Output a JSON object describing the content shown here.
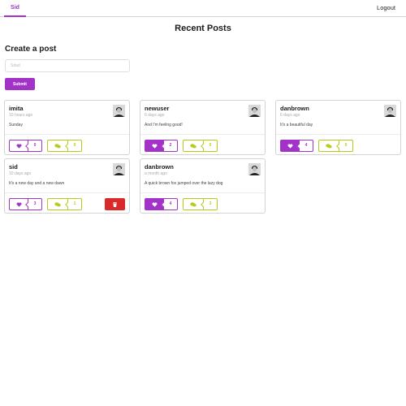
{
  "nav": {
    "user_label": "Sid",
    "logout_label": "Logout"
  },
  "page_title": "Recent Posts",
  "create_post": {
    "heading": "Create a post",
    "placeholder": "Sdad",
    "submit_label": "Submit"
  },
  "colors": {
    "accent": "#a333c8",
    "comment": "#b5cc18",
    "delete": "#db2828"
  },
  "posts": [
    {
      "author": "imita",
      "time": "10 hours ago",
      "body": "Sunday",
      "likes": "0",
      "comments": "0",
      "liked": false,
      "own_post": false
    },
    {
      "author": "newuser",
      "time": "6 days ago",
      "body": "And I'm feeling good!",
      "likes": "2",
      "comments": "0",
      "liked": true,
      "own_post": false
    },
    {
      "author": "danbrown",
      "time": "6 days ago",
      "body": "It's a beautiful day",
      "likes": "4",
      "comments": "0",
      "liked": true,
      "own_post": false
    },
    {
      "author": "sid",
      "time": "10 days ago",
      "body": "It's a new day and a new dawn",
      "likes": "3",
      "comments": "1",
      "liked": false,
      "own_post": true
    },
    {
      "author": "danbrown",
      "time": "a month ago",
      "body": "A quick brown fox jumped over the lazy dog",
      "likes": "4",
      "comments": "3",
      "liked": true,
      "own_post": false
    }
  ],
  "icons": {
    "like": "heart-icon",
    "comment": "comments-icon",
    "delete": "trash-icon",
    "avatar": "user-avatar"
  }
}
